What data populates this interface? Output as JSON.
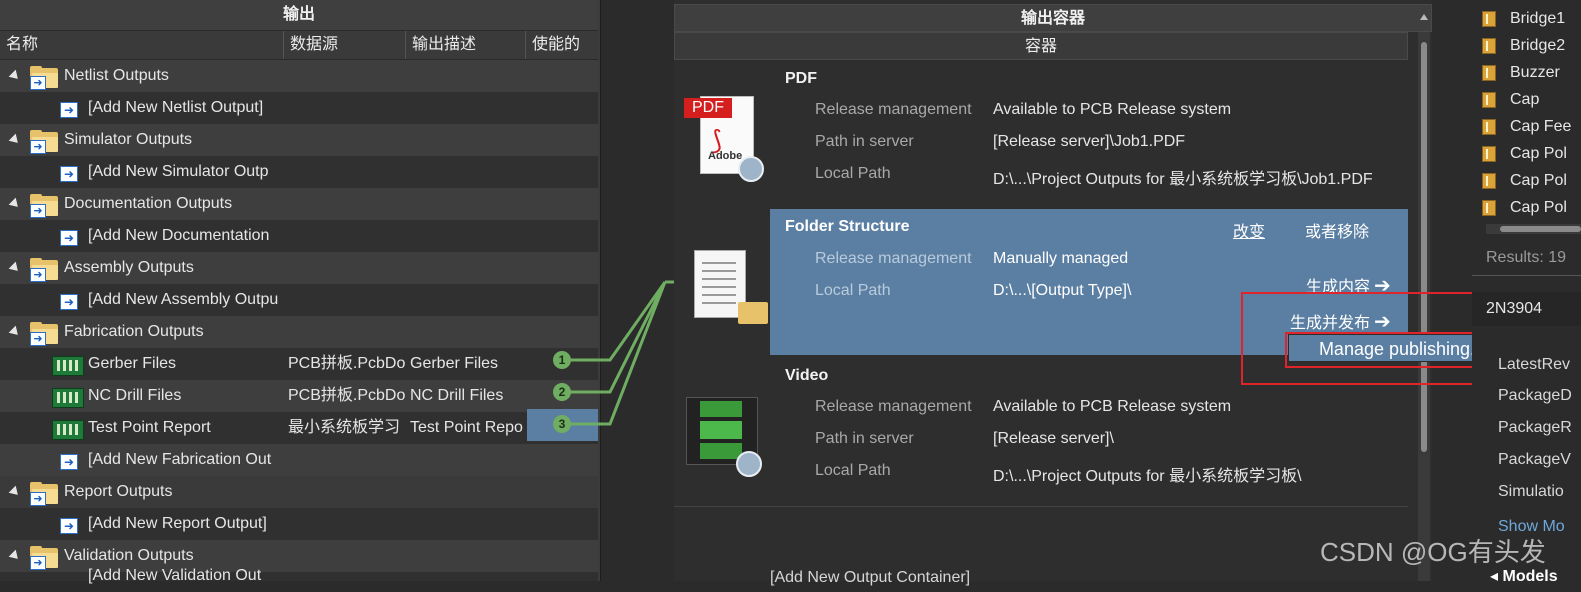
{
  "left": {
    "title": "输出",
    "columns": [
      "名称",
      "数据源",
      "输出描述",
      "使能的"
    ],
    "groups": [
      {
        "label": "Netlist Outputs",
        "add": "[Add New Netlist Output]"
      },
      {
        "label": "Simulator Outputs",
        "add": "[Add New Simulator Outp"
      },
      {
        "label": "Documentation Outputs",
        "add": "[Add New Documentation"
      },
      {
        "label": "Assembly Outputs",
        "add": "[Add New Assembly Outpu"
      },
      {
        "label": "Fabrication Outputs"
      },
      {
        "label": "Report Outputs",
        "add": "[Add New Report Output]"
      },
      {
        "label": "Validation Outputs",
        "add": "[Add New Validation Out"
      }
    ],
    "fab_items": [
      {
        "name": "Gerber Files",
        "source": "PCB拼板.PcbDo",
        "desc": "Gerber Files",
        "badge": "1"
      },
      {
        "name": "NC Drill Files",
        "source": "PCB拼板.PcbDo",
        "desc": "NC Drill Files",
        "badge": "2"
      },
      {
        "name": "Test Point Report",
        "source": "最小系统板学习",
        "desc": "Test Point Repo",
        "badge": "3"
      }
    ],
    "fab_add": "[Add New Fabrication Out"
  },
  "mid": {
    "title": "输出容器",
    "subtitle": "容器",
    "pdf": {
      "icon_text": "PDF",
      "icon_brand": "Adobe",
      "title": "PDF",
      "rows": [
        {
          "k": "Release management",
          "v": "Available to PCB Release system"
        },
        {
          "k": "Path in server",
          "v": "[Release server]\\Job1.PDF"
        },
        {
          "k": "Local Path",
          "v": "D:\\...\\Project Outputs for 最小系统板学习板\\Job1.PDF"
        }
      ]
    },
    "folder": {
      "title": "Folder Structure",
      "change": "改变",
      "remove": "或者移除",
      "rows": [
        {
          "k": "Release management",
          "v": "Manually managed"
        },
        {
          "k": "Local Path",
          "v": "D:\\...\\[Output Type]\\"
        }
      ],
      "generate": "生成内容",
      "publish": "生成并发布",
      "arrow": "➔",
      "manage": "Manage publishing..."
    },
    "video": {
      "title": "Video",
      "rows": [
        {
          "k": "Release management",
          "v": "Available to PCB Release system"
        },
        {
          "k": "Path in server",
          "v": "[Release server]\\"
        },
        {
          "k": "Local Path",
          "v": "D:\\...\\Project Outputs for 最小系统板学习板\\"
        }
      ]
    },
    "add_container": "[Add New Output Container]"
  },
  "right": {
    "items": [
      "Bridge1",
      "Bridge2",
      "Buzzer",
      "Cap",
      "Cap Fee",
      "Cap Pol",
      "Cap Pol",
      "Cap Pol"
    ],
    "results": "Results: 19",
    "search_value": "2N3904",
    "params": [
      "LatestRev",
      "PackageD",
      "PackageR",
      "PackageV",
      "Simulatio"
    ],
    "show_more": "Show Mo",
    "models": "Models"
  },
  "watermark": "CSDN @OG有头发",
  "colors": {
    "selection": "#5b7fa3",
    "badge": "#6fae62",
    "highlight_box": "#e0242b",
    "link_lines": "#6fae62"
  }
}
